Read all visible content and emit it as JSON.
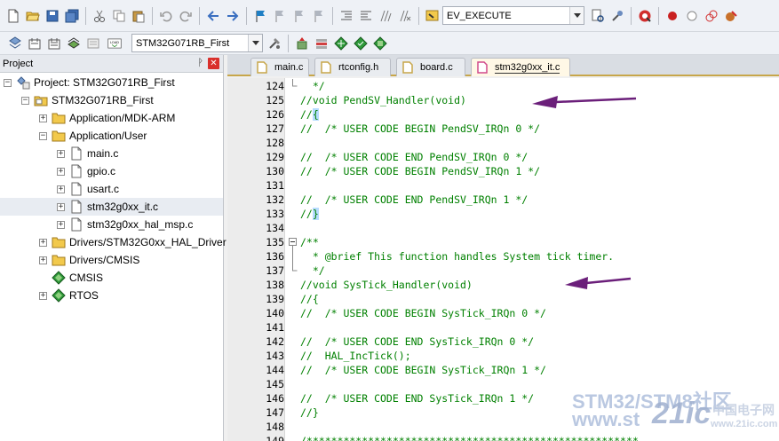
{
  "toolbar1": {
    "target_combo": "EV_EXECUTE",
    "icons": [
      "new-file-icon",
      "open-folder-icon",
      "save-icon",
      "save-all-icon",
      "cut-icon",
      "copy-icon",
      "paste-icon",
      "undo-icon",
      "redo-icon",
      "nav-back-icon",
      "nav-forward-icon",
      "bookmark-icon",
      "prev-bookmark-icon",
      "next-bookmark-icon",
      "clear-bookmarks-icon",
      "indent-icon",
      "unindent-icon",
      "comment-icon",
      "uncomment-icon",
      "find-in-files-icon",
      "find-icon",
      "incremental-find-icon",
      "debug-session-icon",
      "breakpoint-icon",
      "disable-breakpoint-icon",
      "kill-breakpoints-icon",
      "configure-icon"
    ]
  },
  "toolbar2": {
    "target_select": "STM32G071RB_First",
    "load_label": "LOAD"
  },
  "project": {
    "title": "Project",
    "pin": "ᚹ",
    "close": "✕",
    "items": [
      {
        "label": "Project: STM32G071RB_First",
        "icon": "project-icon",
        "expander": "−",
        "indent": 0
      },
      {
        "label": "STM32G071RB_First",
        "icon": "target-folder-icon",
        "expander": "−",
        "indent": 1
      },
      {
        "label": "Application/MDK-ARM",
        "icon": "folder-icon",
        "expander": "+",
        "indent": 2
      },
      {
        "label": "Application/User",
        "icon": "folder-icon",
        "expander": "−",
        "indent": 2
      },
      {
        "label": "main.c",
        "icon": "c-file-icon",
        "expander": "+",
        "indent": 3
      },
      {
        "label": "gpio.c",
        "icon": "c-file-icon",
        "expander": "+",
        "indent": 3
      },
      {
        "label": "usart.c",
        "icon": "c-file-icon",
        "expander": "+",
        "indent": 3
      },
      {
        "label": "stm32g0xx_it.c",
        "icon": "c-file-icon",
        "expander": "+",
        "indent": 3,
        "selected": true
      },
      {
        "label": "stm32g0xx_hal_msp.c",
        "icon": "c-file-icon",
        "expander": "+",
        "indent": 3
      },
      {
        "label": "Drivers/STM32G0xx_HAL_Driver",
        "icon": "folder-icon",
        "expander": "+",
        "indent": 2
      },
      {
        "label": "Drivers/CMSIS",
        "icon": "folder-icon",
        "expander": "+",
        "indent": 2
      },
      {
        "label": "CMSIS",
        "icon": "component-icon",
        "expander": "",
        "indent": 2
      },
      {
        "label": "RTOS",
        "icon": "component-icon",
        "expander": "+",
        "indent": 2
      }
    ]
  },
  "tabs": [
    {
      "label": "main.c",
      "active": false
    },
    {
      "label": "rtconfig.h",
      "active": false
    },
    {
      "label": "board.c",
      "active": false
    },
    {
      "label": "stm32g0xx_it.c",
      "active": true
    }
  ],
  "editor": {
    "lines": [
      {
        "num": "124",
        "code": "  */",
        "fold": "end"
      },
      {
        "num": "125",
        "code": "//void PendSV_Handler(void)",
        "fold": ""
      },
      {
        "num": "126",
        "code": "//{",
        "fold": "",
        "brace": "{"
      },
      {
        "num": "127",
        "code": "//  /* USER CODE BEGIN PendSV_IRQn 0 */",
        "fold": ""
      },
      {
        "num": "128",
        "code": "",
        "fold": ""
      },
      {
        "num": "129",
        "code": "//  /* USER CODE END PendSV_IRQn 0 */",
        "fold": ""
      },
      {
        "num": "130",
        "code": "//  /* USER CODE BEGIN PendSV_IRQn 1 */",
        "fold": ""
      },
      {
        "num": "131",
        "code": "",
        "fold": ""
      },
      {
        "num": "132",
        "code": "//  /* USER CODE END PendSV_IRQn 1 */",
        "fold": ""
      },
      {
        "num": "133",
        "code": "//}",
        "fold": "",
        "brace": "}"
      },
      {
        "num": "134",
        "code": "",
        "fold": ""
      },
      {
        "num": "135",
        "code": "/**",
        "fold": "start"
      },
      {
        "num": "136",
        "code": "  * @brief This function handles System tick timer.",
        "fold": "mid"
      },
      {
        "num": "137",
        "code": "  */",
        "fold": "end"
      },
      {
        "num": "138",
        "code": "//void SysTick_Handler(void)",
        "fold": ""
      },
      {
        "num": "139",
        "code": "//{",
        "fold": ""
      },
      {
        "num": "140",
        "code": "//  /* USER CODE BEGIN SysTick_IRQn 0 */",
        "fold": ""
      },
      {
        "num": "141",
        "code": "",
        "fold": ""
      },
      {
        "num": "142",
        "code": "//  /* USER CODE END SysTick_IRQn 0 */",
        "fold": ""
      },
      {
        "num": "143",
        "code": "//  HAL_IncTick();",
        "fold": ""
      },
      {
        "num": "144",
        "code": "//  /* USER CODE BEGIN SysTick_IRQn 1 */",
        "fold": ""
      },
      {
        "num": "145",
        "code": "",
        "fold": ""
      },
      {
        "num": "146",
        "code": "//  /* USER CODE END SysTick_IRQn 1 */",
        "fold": ""
      },
      {
        "num": "147",
        "code": "//}",
        "fold": ""
      },
      {
        "num": "148",
        "code": "",
        "fold": ""
      },
      {
        "num": "149",
        "code": "/******************************************************",
        "fold": ""
      }
    ]
  },
  "watermark": {
    "line1": "STM32/STM8社区",
    "line2": "www.st",
    "logo": "21ic",
    "logo_sub": "中国电子网",
    "url": "www.21ic.com"
  },
  "colors": {
    "comment_green": "#008000",
    "arrow_purple": "#6b1f7a",
    "tab_accent": "#c7a64a",
    "brace_highlight": "#b7dcff"
  }
}
